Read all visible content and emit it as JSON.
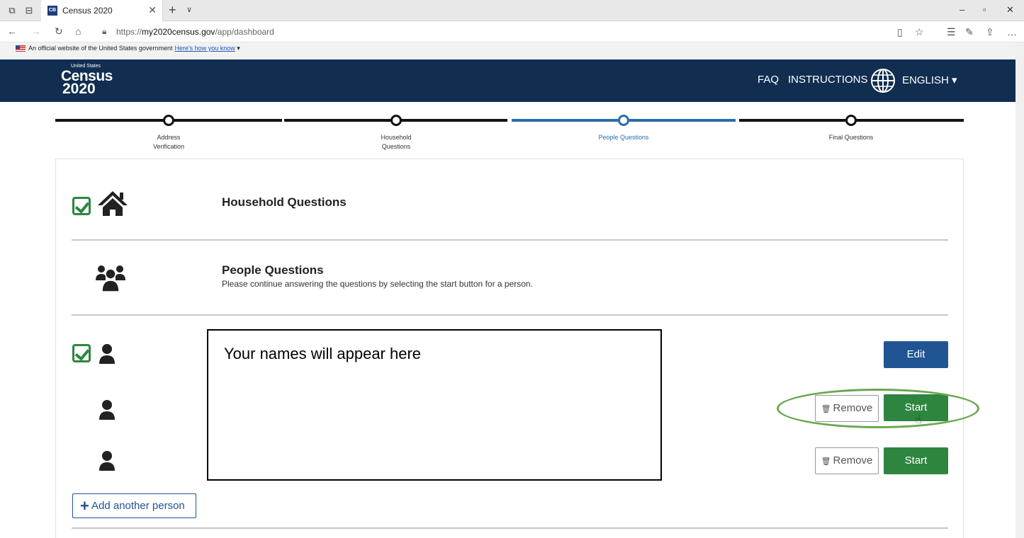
{
  "browser": {
    "tab_title": "Census 2020",
    "tab_favicon": "CB",
    "url_prefix": "https://",
    "url_domain": "my2020census.gov",
    "url_path": "/app/dashboard"
  },
  "gov_banner": {
    "text": "An official website of the United States government",
    "link": "Here's how you know"
  },
  "header": {
    "logo_top": "United States",
    "logo_main": "Census",
    "logo_year": "2020",
    "faq": "FAQ",
    "instructions": "INSTRUCTIONS",
    "language": "ENGLISH"
  },
  "stepper": {
    "steps": [
      {
        "label_line1": "Address",
        "label_line2": "Verification",
        "status": "done"
      },
      {
        "label_line1": "Household",
        "label_line2": "Questions",
        "status": "done"
      },
      {
        "label_line1": "People Questions",
        "label_line2": "",
        "status": "current"
      },
      {
        "label_line1": "Final Questions",
        "label_line2": "",
        "status": "todo"
      }
    ]
  },
  "sections": {
    "household": {
      "title": "Household Questions",
      "complete": true
    },
    "people": {
      "title": "People Questions",
      "subtitle": "Please continue answering the questions by selecting the start button for a person."
    }
  },
  "namebox": {
    "text": "Your names will appear here"
  },
  "persons": [
    {
      "complete": true,
      "action": "Edit"
    },
    {
      "complete": false,
      "remove": "Remove",
      "action": "Start"
    },
    {
      "complete": false,
      "remove": "Remove",
      "action": "Start"
    }
  ],
  "add_person": "Add another person",
  "colors": {
    "header_bg": "#112e51",
    "accent_blue": "#205493",
    "success_green": "#2e8540",
    "highlight_green": "#6aa84f"
  }
}
